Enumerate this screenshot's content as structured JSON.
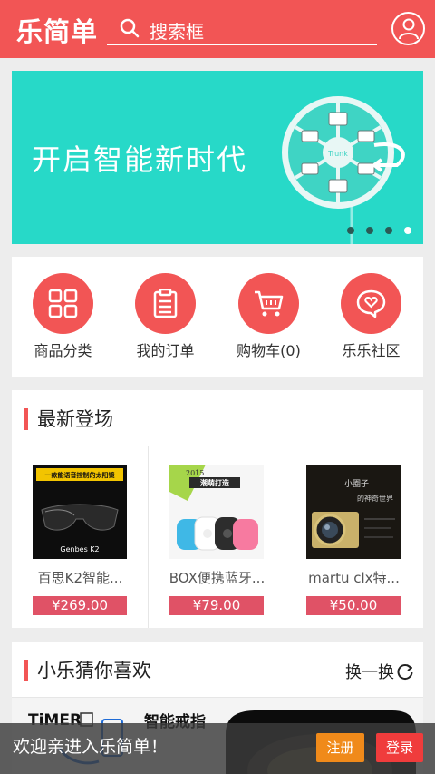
{
  "header": {
    "logo": "乐简单",
    "search_placeholder": "搜索框"
  },
  "banner": {
    "headline": "开启智能新时代",
    "product_label": "Trunk",
    "slide_count": 4,
    "active_slide": 4
  },
  "nav": [
    {
      "label": "商品分类",
      "icon": "grid-icon"
    },
    {
      "label": "我的订单",
      "icon": "order-list-icon"
    },
    {
      "label": "购物车(0)",
      "icon": "cart-icon"
    },
    {
      "label": "乐乐社区",
      "icon": "chat-bubble-icon"
    }
  ],
  "newest": {
    "title": "最新登场",
    "products": [
      {
        "name": "百思K2智能...",
        "price": "¥269.00",
        "img_caption": "一款能语音控制的太阳镜",
        "img_brand": "Genbes K2"
      },
      {
        "name": "BOX便携蓝牙...",
        "price": "¥79.00",
        "img_caption": "2015",
        "img_brand": "潮萌打造"
      },
      {
        "name": "martu clx特...",
        "price": "¥50.00",
        "img_caption": "小圈子",
        "img_brand": "的神奇世界"
      }
    ]
  },
  "guess": {
    "title": "小乐猜你喜欢",
    "refresh_label": "换一换",
    "promo_brand": "TiMER",
    "promo_text": "智能戒指"
  },
  "toast": {
    "message": "欢迎亲进入乐简单！",
    "register_label": "注册",
    "login_label": "登录"
  },
  "colors": {
    "brand_red": "#f25555",
    "banner_teal": "#27d9c8",
    "price_red": "#e05266",
    "register_orange": "#f08a1a"
  }
}
